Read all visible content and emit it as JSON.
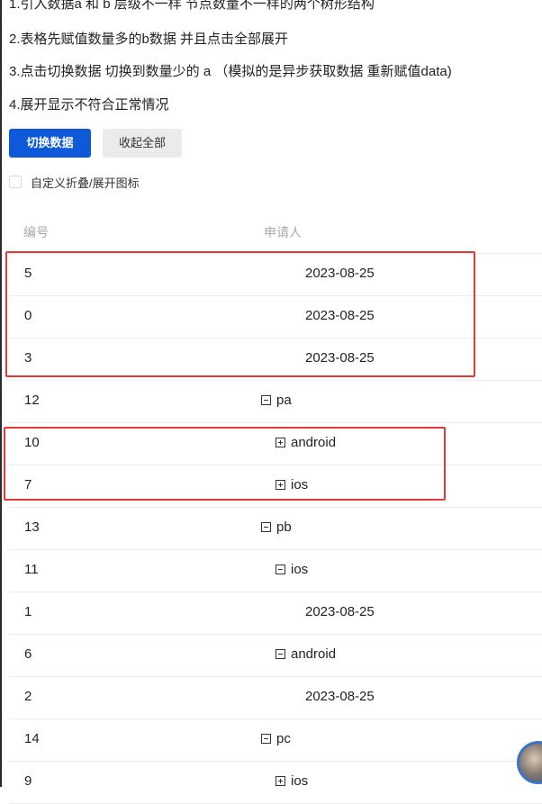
{
  "instructions": [
    "1.引入数据a 和 b 层级不一样 节点数量不一样的两个树形结构",
    "2.表格先赋值数量多的b数据 并且点击全部展开",
    "3.点击切换数据 切换到数量少的 a （模拟的是异步获取数据 重新赋值data)",
    "4.展开显示不符合正常情况"
  ],
  "buttons": {
    "switch_data": "切换数据",
    "collapse_all": "收起全部"
  },
  "checkbox": {
    "label": "自定义折叠/展开图标",
    "checked": false
  },
  "table": {
    "headers": [
      "编号",
      "申请人"
    ],
    "rows": [
      {
        "id": "5",
        "text": "2023-08-25",
        "level": 2,
        "toggle": null
      },
      {
        "id": "0",
        "text": "2023-08-25",
        "level": 2,
        "toggle": null
      },
      {
        "id": "3",
        "text": "2023-08-25",
        "level": 2,
        "toggle": null
      },
      {
        "id": "12",
        "text": "pa",
        "level": 0,
        "toggle": "minus"
      },
      {
        "id": "10",
        "text": "android",
        "level": 1,
        "toggle": "plus"
      },
      {
        "id": "7",
        "text": "ios",
        "level": 1,
        "toggle": "plus"
      },
      {
        "id": "13",
        "text": "pb",
        "level": 0,
        "toggle": "minus"
      },
      {
        "id": "11",
        "text": "ios",
        "level": 1,
        "toggle": "minus"
      },
      {
        "id": "1",
        "text": "2023-08-25",
        "level": 2,
        "toggle": null
      },
      {
        "id": "6",
        "text": "android",
        "level": 1,
        "toggle": "minus"
      },
      {
        "id": "2",
        "text": "2023-08-25",
        "level": 2,
        "toggle": null
      },
      {
        "id": "14",
        "text": "pc",
        "level": 0,
        "toggle": "minus"
      },
      {
        "id": "9",
        "text": "ios",
        "level": 1,
        "toggle": "plus"
      }
    ]
  },
  "colors": {
    "primary": "#0d59d9",
    "highlight": "#e53935",
    "row_border": "#ececec"
  }
}
